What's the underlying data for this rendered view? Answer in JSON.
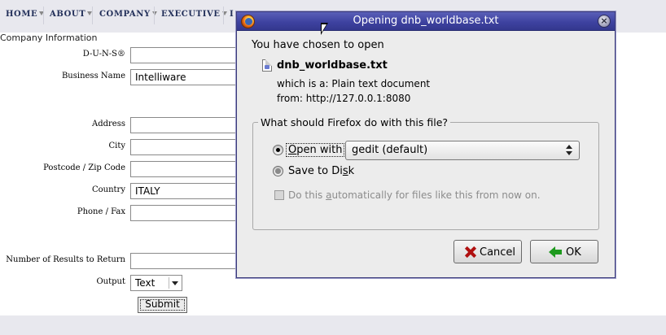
{
  "nav": {
    "items": [
      {
        "label": "HOME"
      },
      {
        "label": "ABOUT"
      },
      {
        "label": "COMPANY"
      },
      {
        "label": "EXECUTIVE"
      },
      {
        "label": "I"
      }
    ]
  },
  "form": {
    "section_title": "Company Information",
    "fields": [
      {
        "label": "D-U-N-S®",
        "value": ""
      },
      {
        "label": "Business Name",
        "value": "Intelliware"
      },
      {
        "label": "Address",
        "value": ""
      },
      {
        "label": "City",
        "value": ""
      },
      {
        "label": "Postcode / Zip Code",
        "value": ""
      },
      {
        "label": "Country",
        "value": "ITALY"
      },
      {
        "label": "Phone / Fax",
        "value": ""
      },
      {
        "label": "Number of Results to Return",
        "value": ""
      }
    ],
    "output_label": "Output",
    "output_value": "Text",
    "submit_label": "Submit"
  },
  "dialog": {
    "title": "Opening dnb_worldbase.txt",
    "intro": "You have chosen to open",
    "filename": "dnb_worldbase.txt",
    "which_is_label": "which is a:",
    "which_is_value": "Plain text document",
    "from_label": "from:",
    "from_value": "http://127.0.0.1:8080",
    "question": "What should Firefox do with this file?",
    "open_with": {
      "pre": "",
      "mnemonic": "O",
      "post": "pen with",
      "selected": true
    },
    "app_choice": "gedit (default)",
    "save_to_disk": {
      "pre": "Save to Di",
      "mnemonic": "s",
      "post": "k",
      "selected": false
    },
    "auto": {
      "pre": "Do this ",
      "mnemonic": "a",
      "post": "utomatically for files like this from now on.",
      "checked": false,
      "enabled": false
    },
    "cancel_label": "Cancel",
    "ok_label": "OK"
  },
  "icons": {
    "titlebar": "firefox-icon",
    "close": "close-icon",
    "file": "text-file-icon",
    "cancel": "red-x-icon",
    "ok": "green-arrow-icon",
    "pointer": "mouse-pointer-icon"
  }
}
